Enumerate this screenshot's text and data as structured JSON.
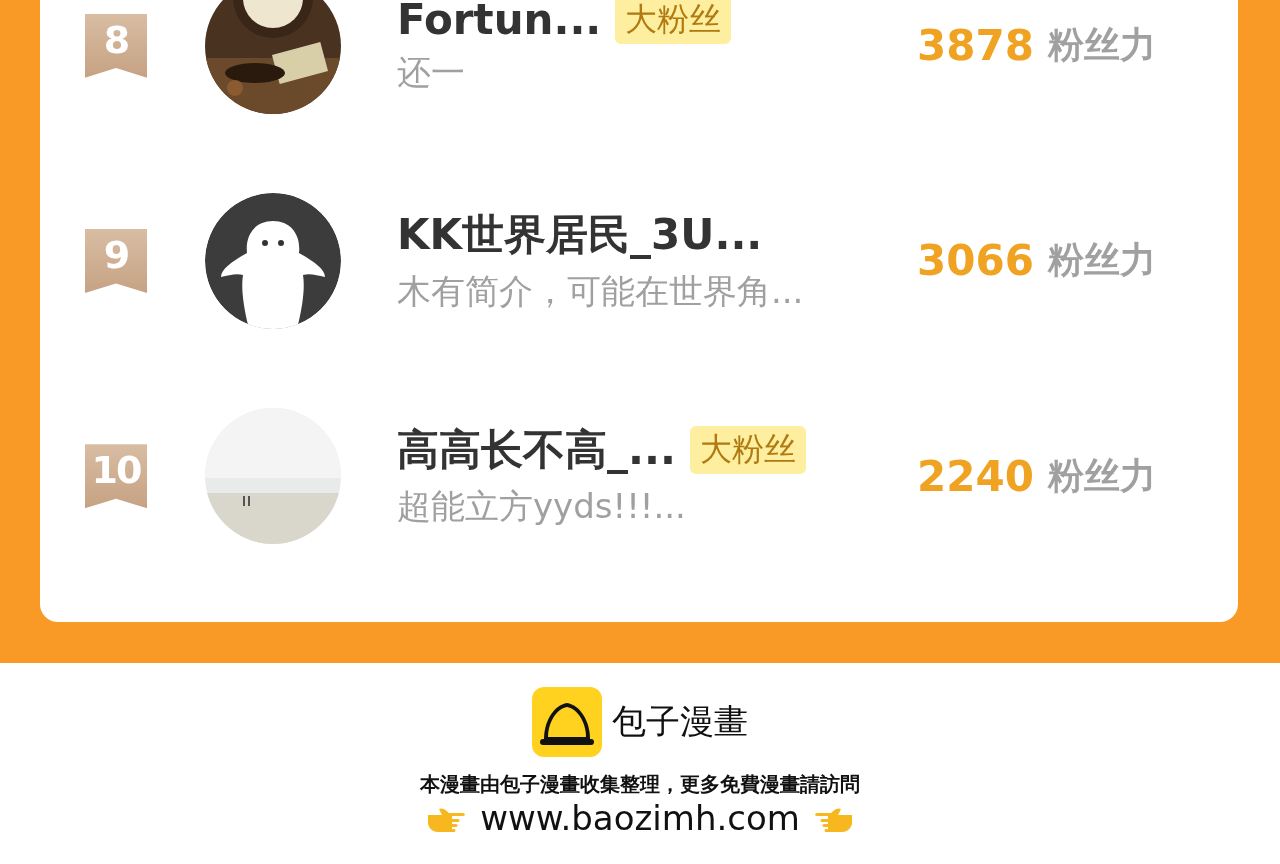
{
  "ranking": [
    {
      "rank": "8",
      "name": "Fortun...",
      "badge": "大粉丝",
      "bio": "还一",
      "score": "3878",
      "score_unit": "粉丝力"
    },
    {
      "rank": "9",
      "avatar": {
        "kind": "default"
      },
      "name": "KK世界居民_3U...",
      "bio": "木有简介，可能在世界角...",
      "score": "3066",
      "score_unit": "粉丝力"
    },
    {
      "rank": "10",
      "name": "高高长不高_...",
      "badge": "大粉丝",
      "bio": "超能立方yyds!!!...",
      "score": "2240",
      "score_unit": "粉丝力"
    }
  ],
  "footer": {
    "brand": "包子漫畫",
    "notice": "本漫畫由包子漫畫收集整理，更多免費漫畫請訪問",
    "url": "www.baozimh.com"
  }
}
